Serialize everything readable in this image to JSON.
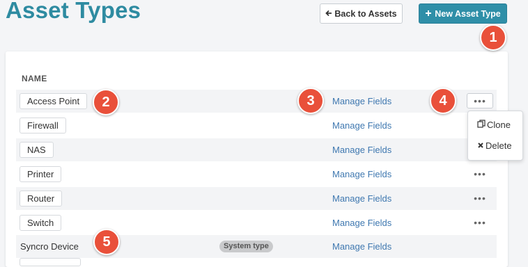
{
  "page": {
    "title": "Asset Types"
  },
  "header": {
    "back_label": "Back to Assets",
    "back_icon": "arrow-left-icon",
    "new_label": "New Asset Type",
    "new_icon": "plus-icon"
  },
  "table": {
    "column_name": "NAME",
    "manage_label": "Manage Fields",
    "system_badge": "System type",
    "rows": [
      {
        "name": "Access Point"
      },
      {
        "name": "Firewall"
      },
      {
        "name": "NAS"
      },
      {
        "name": "Printer"
      },
      {
        "name": "Router"
      },
      {
        "name": "Switch"
      },
      {
        "name": "Syncro Device"
      }
    ]
  },
  "row_menu": {
    "clone_label": "Clone",
    "delete_label": "Delete"
  },
  "annotations": [
    "1",
    "2",
    "3",
    "4",
    "5"
  ],
  "colors": {
    "title": "#2e8ba1",
    "primary_button": "#2f8fa8",
    "link": "#3f78b0",
    "annotation": "#e9503a"
  }
}
